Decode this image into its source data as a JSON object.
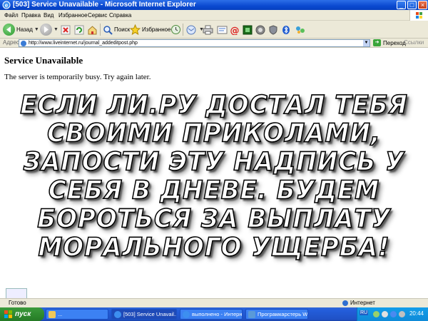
{
  "window": {
    "title": "[503] Service Unavailable - Microsoft Internet Explorer"
  },
  "menu": {
    "items": [
      "Файл",
      "Правка",
      "Вид",
      "Избранное",
      "Сервис",
      "Справка"
    ]
  },
  "toolbar": {
    "back_label": "Назад",
    "search_label": "Поиск",
    "favorites_label": "Избранное"
  },
  "address": {
    "label": "Адрес",
    "url": "http://www.liveinternet.ru/journal_addeditpost.php",
    "go_label": "Переход",
    "links_label": "Ссылки"
  },
  "page": {
    "heading": "Service Unavailable",
    "message": "The server is temporarily busy. Try again later.",
    "overlay_lines": [
      "ЕСЛИ ЛИ.РУ ДОСТАЛ ТЕБЯ",
      "СВОИМИ ПРИКОЛАМИ,",
      "ЗАПОСТИ ЭТУ НАДПИСЬ У",
      "СЕБЯ В ДНЕВЕ. БУДЕМ",
      "БОРОТЬСЯ ЗА ВЫПЛАТУ",
      "МОРАЛЬНОГО УЩЕРБА!"
    ]
  },
  "status": {
    "ready": "Готово",
    "zone": "Интернет"
  },
  "taskbar": {
    "start_label": "пуск",
    "tasks": [
      {
        "label": "..."
      },
      {
        "label": "[503] Service Unavail..."
      },
      {
        "label": "выполнено - Интерн..."
      },
      {
        "label": "Програмкаpcтеpь Wi..."
      }
    ],
    "lang": "RU",
    "clock": "20:44"
  }
}
